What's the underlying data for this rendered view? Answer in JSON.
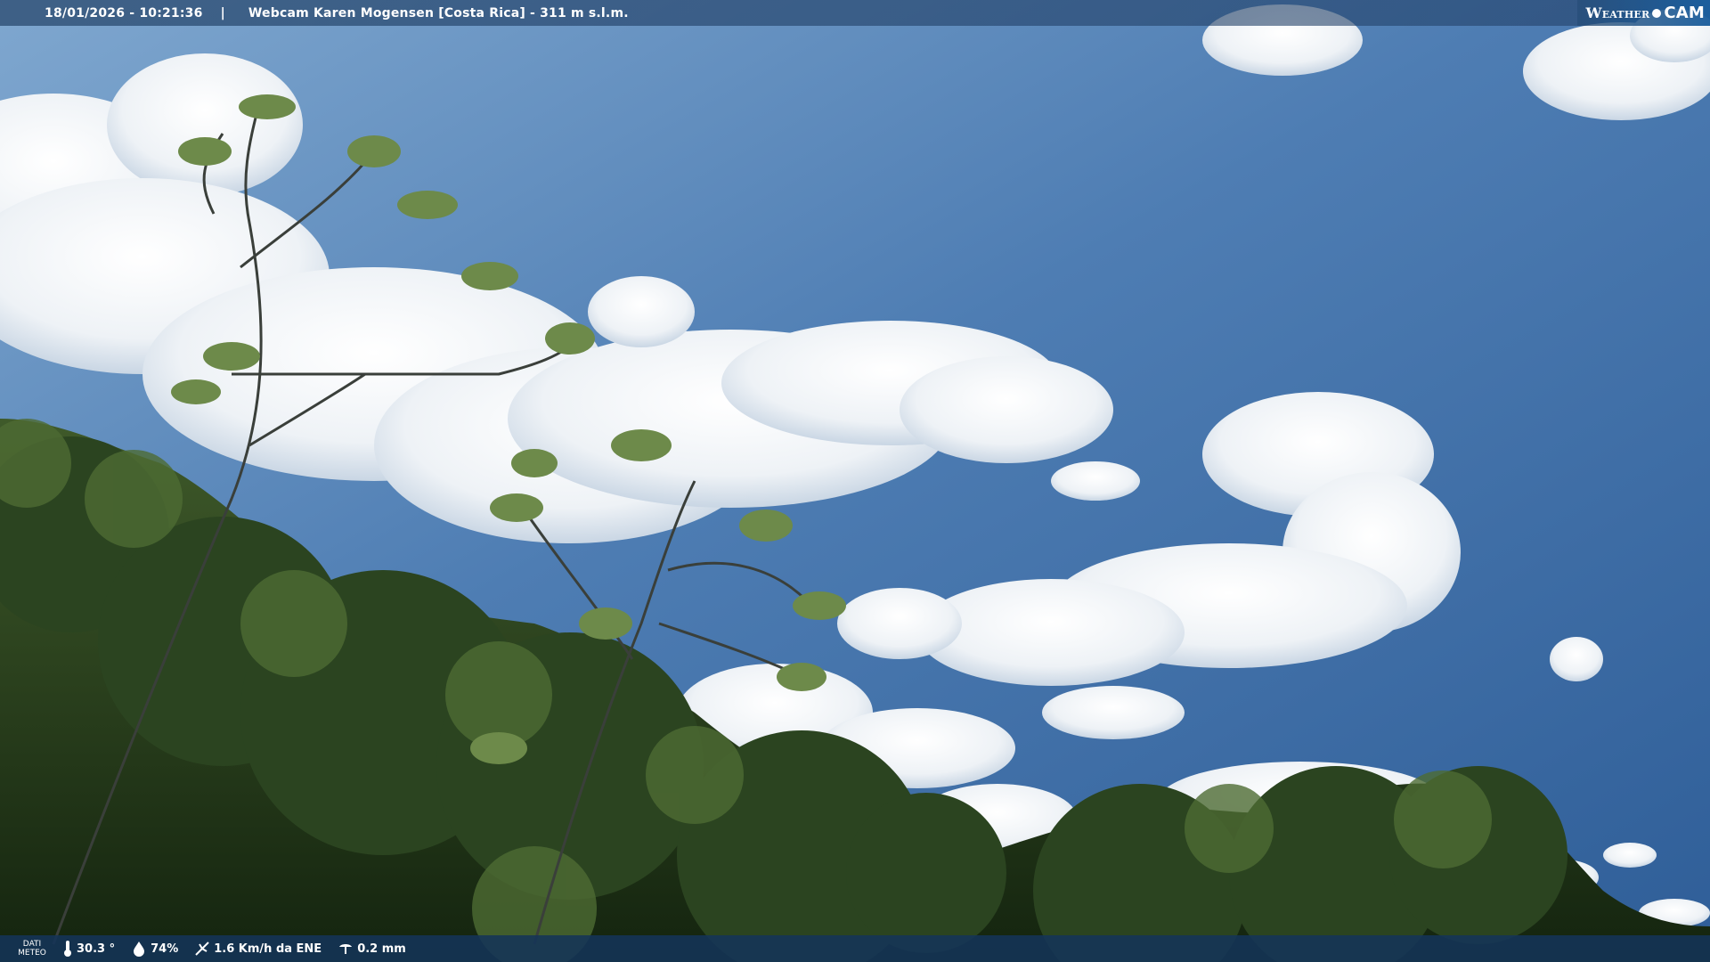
{
  "header": {
    "datetime": "18/01/2026 - 10:21:36",
    "separator": "|",
    "title": "Webcam Karen Mogensen [Costa Rica]  - 311 m s.l.m."
  },
  "logo": {
    "weather": "Weather",
    "cam": "CAM"
  },
  "footer": {
    "data_label_line1": "DATI",
    "data_label_line2": "METEO",
    "temperature": "30.3 °",
    "humidity": "74%",
    "wind": "1.6 Km/h da ENE",
    "rain": "0.2 mm"
  },
  "icons": [
    "thermometer-icon",
    "humidity-drop-icon",
    "wind-icon",
    "rain-gauge-icon"
  ],
  "colors": {
    "sky_top": "#3d6aa0",
    "sky_bottom": "#5f8ec2",
    "bar": "#1e3e66"
  }
}
